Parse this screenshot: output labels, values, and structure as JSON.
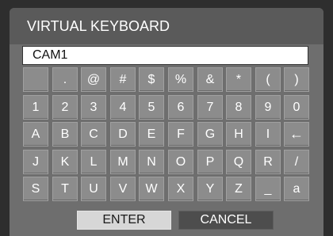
{
  "dialog": {
    "title": "VIRTUAL KEYBOARD",
    "input_value": "CAM1",
    "enter_label": "ENTER",
    "cancel_label": "CANCEL"
  },
  "keyboard": {
    "rows": [
      [
        " ",
        ".",
        "@",
        "#",
        "$",
        "%",
        "&",
        "*",
        "(",
        ")"
      ],
      [
        "1",
        "2",
        "3",
        "4",
        "5",
        "6",
        "7",
        "8",
        "9",
        "0"
      ],
      [
        "A",
        "B",
        "C",
        "D",
        "E",
        "F",
        "G",
        "H",
        "I",
        "←"
      ],
      [
        "J",
        "K",
        "L",
        "M",
        "N",
        "O",
        "P",
        "Q",
        "R",
        "/"
      ],
      [
        "S",
        "T",
        "U",
        "V",
        "W",
        "X",
        "Y",
        "Z",
        "_",
        "a"
      ]
    ]
  }
}
